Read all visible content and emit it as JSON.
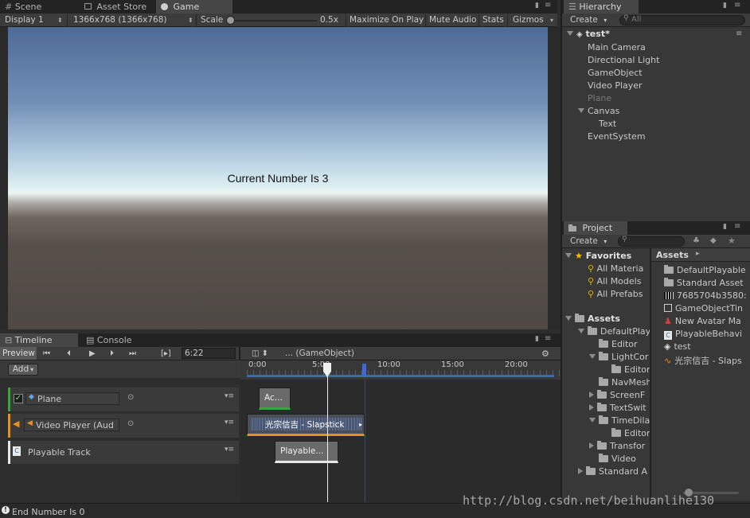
{
  "game_tabs": [
    {
      "label": "Scene",
      "icon": "hash-icon"
    },
    {
      "label": "Asset Store",
      "icon": "store-icon"
    },
    {
      "label": "Game",
      "icon": "pacman-icon"
    }
  ],
  "game_toolbar": {
    "display": "Display 1",
    "resolution": "1366x768 (1366x768)",
    "scale_label": "Scale",
    "scale_value": "0.5x",
    "maximize": "Maximize On Play",
    "mute": "Mute Audio",
    "stats": "Stats",
    "gizmos": "Gizmos"
  },
  "game_view": {
    "overlay_text": "Current Number Is 3"
  },
  "hierarchy": {
    "tab": "Hierarchy",
    "create": "Create",
    "search_placeholder": "All",
    "scene": "test*",
    "items": [
      {
        "label": "Main Camera",
        "disabled": false
      },
      {
        "label": "Directional Light",
        "disabled": false
      },
      {
        "label": "GameObject",
        "disabled": false
      },
      {
        "label": "Video Player",
        "disabled": false
      },
      {
        "label": "Plane",
        "disabled": true
      },
      {
        "label": "Canvas",
        "disabled": false
      },
      {
        "label": "Text",
        "disabled": false
      },
      {
        "label": "EventSystem",
        "disabled": false
      }
    ]
  },
  "project": {
    "tab": "Project",
    "create": "Create",
    "favorites": "Favorites",
    "favorite_items": [
      "All Materia",
      "All Models",
      "All Prefabs"
    ],
    "assets_root": "Assets",
    "tree": [
      "DefaultPlay",
      "Editor",
      "LightCor",
      "Editor",
      "NavMesh",
      "ScreenF",
      "TextSwit",
      "TimeDila",
      "Editor",
      "Transfor",
      "Video",
      "Standard A"
    ],
    "assets_header": "Assets",
    "assets_items": [
      {
        "label": "DefaultPlayable",
        "icon": "folder-icon"
      },
      {
        "label": "Standard Asset",
        "icon": "folder-icon"
      },
      {
        "label": "7685704b3580:",
        "icon": "video-clip-icon"
      },
      {
        "label": "GameObjectTin",
        "icon": "timeline-asset-icon"
      },
      {
        "label": "New Avatar Ma",
        "icon": "avatar-mask-icon"
      },
      {
        "label": "PlayableBehavi",
        "icon": "csharp-script-icon"
      },
      {
        "label": "test",
        "icon": "unity-scene-icon"
      },
      {
        "label": "光宗信吉 - Slaps",
        "icon": "audio-clip-icon"
      }
    ]
  },
  "timeline": {
    "tab": "Timeline",
    "console_tab": "Console",
    "preview": "Preview",
    "frame": "6:22",
    "binding": "... (GameObject)",
    "add": "Add",
    "ruler": [
      "0:00",
      "5:00",
      "10:00",
      "15:00",
      "20:00"
    ],
    "tracks": [
      {
        "label": "Plane",
        "color": "#3aa63a",
        "type": "activation"
      },
      {
        "label": "Video Player (Aud",
        "color": "#e8901e",
        "type": "audio"
      },
      {
        "label": "Playable Track",
        "color": "#e8e8e8",
        "type": "playable"
      }
    ],
    "clips": [
      "Ac...",
      "光宗信吉 - Slapstick",
      "Playable..."
    ]
  },
  "status_bar": {
    "message": "End Number Is 0"
  },
  "watermark": "http://blog.csdn.net/beihuanlihe130"
}
